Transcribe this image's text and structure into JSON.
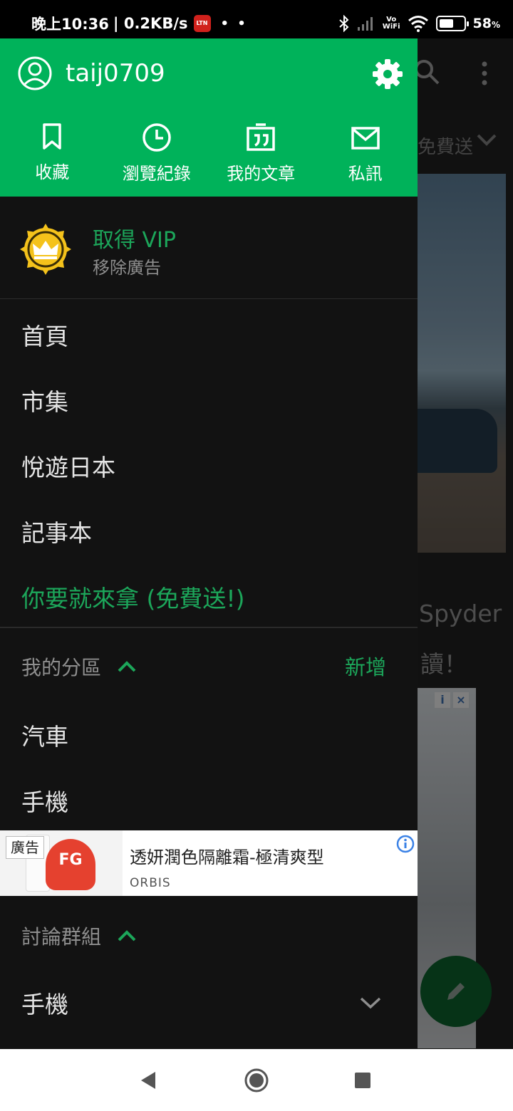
{
  "status_bar": {
    "time": "晚上10:36",
    "network_speed": "| 0.2KB/s",
    "notification_icon_text": "LTN",
    "notification_dots": "• •",
    "vowifi_top": "Vo",
    "vowifi_bottom": "WiFi",
    "battery_percent": "58",
    "battery_unit": "%",
    "battery_level": 0.58
  },
  "drawer": {
    "username": "taij0709",
    "quick_actions": [
      {
        "label": "收藏",
        "icon": "bookmark-icon"
      },
      {
        "label": "瀏覽紀錄",
        "icon": "history-icon"
      },
      {
        "label": "我的文章",
        "icon": "article-quote-icon"
      },
      {
        "label": "私訊",
        "icon": "mail-icon"
      }
    ],
    "vip": {
      "title": "取得 VIP",
      "subtitle": "移除廣告"
    },
    "menu": [
      "首頁",
      "市集",
      "悅遊日本",
      "記事本"
    ],
    "free_item": "你要就來拿 (免費送!)",
    "my_boards": {
      "title": "我的分區",
      "add_label": "新增",
      "items": [
        "汽車",
        "手機"
      ]
    },
    "ad": {
      "tag": "廣告",
      "badge": "FG",
      "headline": "透妍潤色隔離霜-極清爽型",
      "brand": "ORBIS"
    },
    "groups": {
      "title": "討論群組",
      "items": [
        "手機"
      ]
    }
  },
  "background_app": {
    "tab_text": "免費送",
    "article_title_fragment": "Spyder",
    "article_sub_fragment": "讀！"
  },
  "colors": {
    "brand_green": "#00b25a",
    "accent_green": "#1ca65a",
    "drawer_bg": "#121212",
    "vip_gold": "#f4c21b"
  }
}
